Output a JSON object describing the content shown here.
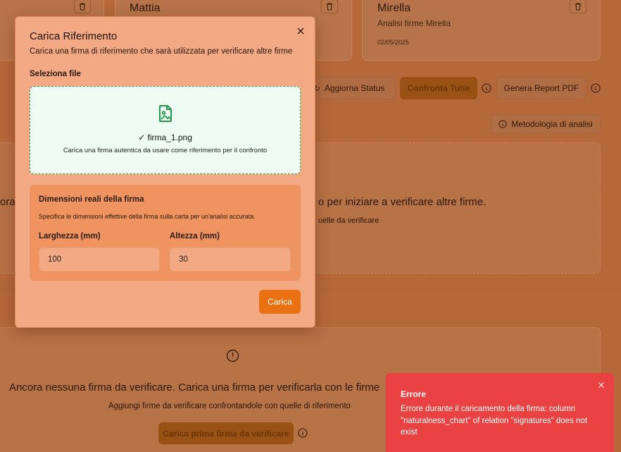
{
  "background": {
    "cards": [
      {
        "name": "",
        "subtitle": "",
        "date": ""
      },
      {
        "name": "Mattia",
        "subtitle": "",
        "date": ""
      },
      {
        "name": "Mirella",
        "subtitle": "Analisi firme Mirella",
        "date": "02/05/2025"
      }
    ],
    "toolbar": {
      "refresh_label": "Aggiorna Status",
      "compare_all_label": "Confronta Tutte",
      "report_label": "Genera Report PDF",
      "methodology_label": "Metodologia di analisi"
    },
    "reference_empty": {
      "fragment_left": "ora",
      "fragment_main": "o per iniziare a verificare altre firme.",
      "fragment_sub": "uelle da verificare"
    },
    "verify_empty": {
      "title": "Ancora nessuna firma da verificare. Carica una firma per verificarla con le firme",
      "subtitle": "Aggiungi firme da verificare confrontandole con quelle di riferimento",
      "button_label": "Carica prima firma da verificare"
    }
  },
  "modal": {
    "title": "Carica Riferimento",
    "description": "Carica una firma di riferimento che sarà utilizzata per verificare altre firme",
    "file_section_label": "Seleziona file",
    "file_name": "✓ firma_1.png",
    "file_hint": "Carica una firma autentica da usare come riferimento per il confronto",
    "dimensions": {
      "title": "Dimensioni reali della firma",
      "hint": "Specifica le dimensioni effettive della firma sulla carta per un'analisi accurata.",
      "width_label": "Larghezza (mm)",
      "width_value": "100",
      "height_label": "Altezza (mm)",
      "height_value": "30"
    },
    "submit_label": "Carica"
  },
  "toast": {
    "title": "Errore",
    "message": "Errore durante il caricamento della firma: column \"naturalness_chart\" of relation \"signatures\" does not exist"
  },
  "colors": {
    "accent": "#ea7111",
    "error": "#ea4242",
    "success": "#3a9a55"
  }
}
